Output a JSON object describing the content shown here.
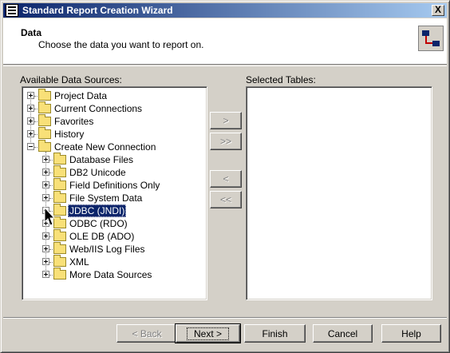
{
  "window": {
    "title": "Standard Report Creation Wizard",
    "close_label": "X"
  },
  "header": {
    "title": "Data",
    "subtitle": "Choose the data you want to report on.",
    "icon": "data-link-icon"
  },
  "left_panel": {
    "label": "Available Data Sources:",
    "items": [
      {
        "label": "Project Data",
        "level": 0,
        "expander": "plus"
      },
      {
        "label": "Current Connections",
        "level": 0,
        "expander": "plus"
      },
      {
        "label": "Favorites",
        "level": 0,
        "expander": "plus"
      },
      {
        "label": "History",
        "level": 0,
        "expander": "plus"
      },
      {
        "label": "Create New Connection",
        "level": 0,
        "expander": "minus"
      },
      {
        "label": "Database Files",
        "level": 1,
        "expander": "plus"
      },
      {
        "label": "DB2 Unicode",
        "level": 1,
        "expander": "plus"
      },
      {
        "label": "Field Definitions Only",
        "level": 1,
        "expander": "plus"
      },
      {
        "label": "File System Data",
        "level": 1,
        "expander": "plus"
      },
      {
        "label": "JDBC (JNDI)",
        "level": 1,
        "expander": "plus",
        "selected": true
      },
      {
        "label": "ODBC (RDO)",
        "level": 1,
        "expander": "plus"
      },
      {
        "label": "OLE DB (ADO)",
        "level": 1,
        "expander": "plus"
      },
      {
        "label": "Web/IIS Log Files",
        "level": 1,
        "expander": "plus"
      },
      {
        "label": "XML",
        "level": 1,
        "expander": "plus"
      },
      {
        "label": "More Data Sources",
        "level": 1,
        "expander": "plus"
      }
    ]
  },
  "right_panel": {
    "label": "Selected Tables:"
  },
  "transfer_buttons": {
    "add": ">",
    "add_all": ">>",
    "remove": "<",
    "remove_all": "<<"
  },
  "footer": {
    "back": "< Back",
    "next": "Next >",
    "finish": "Finish",
    "cancel": "Cancel",
    "help": "Help"
  },
  "colors": {
    "face": "#d4d0c8",
    "title_start": "#0a246a",
    "title_end": "#a6caf0",
    "selection": "#0a246a",
    "folder": "#f8e078"
  }
}
